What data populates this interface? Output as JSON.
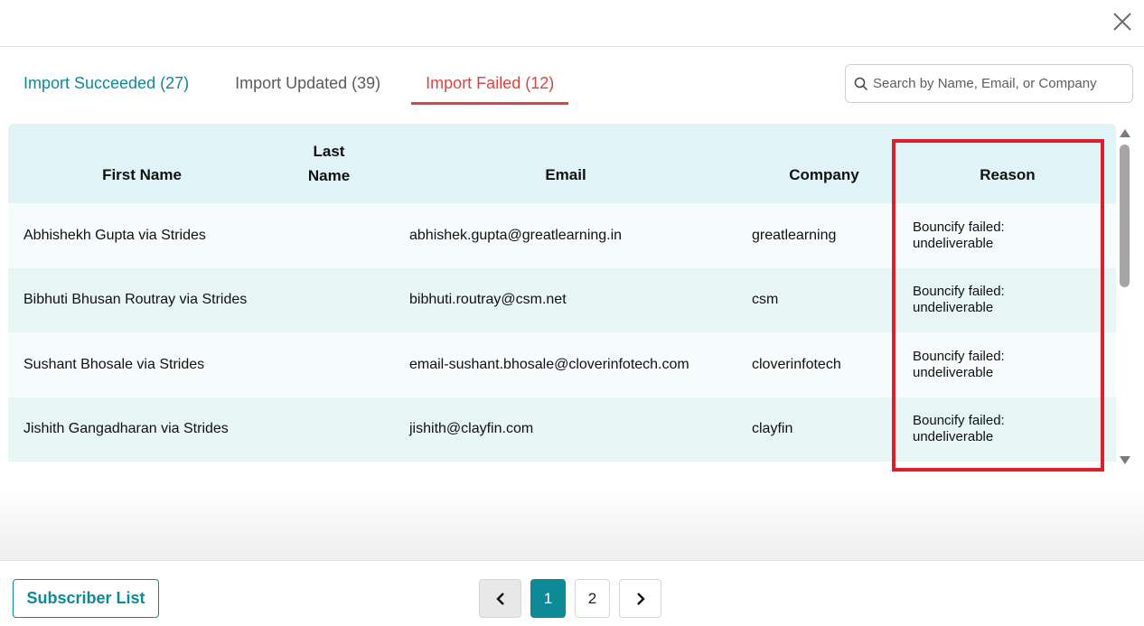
{
  "dialog": {
    "close_icon": "close-icon"
  },
  "tabs": [
    {
      "label": "Import Succeeded (27)",
      "color": "#0e8a96"
    },
    {
      "label": "Import Updated (39)",
      "color": "#5b5b5b"
    },
    {
      "label": "Import Failed (12)",
      "color": "#e2423f",
      "active": true
    }
  ],
  "search": {
    "placeholder": "Search by Name, Email, or Company",
    "value": ""
  },
  "table": {
    "headers": {
      "first_name": "First Name",
      "last_name_line1": "Last",
      "last_name_line2": "Name",
      "email": "Email",
      "company": "Company",
      "reason": "Reason"
    },
    "rows": [
      {
        "first_name": "Abhishekh Gupta via Strides",
        "last_name": "",
        "email": "abhishek.gupta@greatlearning.in",
        "company": "greatlearning",
        "reason_line1": "Bouncify failed:",
        "reason_line2": "undeliverable"
      },
      {
        "first_name": "Bibhuti Bhusan Routray via Strides",
        "last_name": "",
        "email": "bibhuti.routray@csm.net",
        "company": "csm",
        "reason_line1": "Bouncify failed:",
        "reason_line2": "undeliverable"
      },
      {
        "first_name": "Sushant Bhosale via Strides",
        "last_name": "",
        "email": "email-sushant.bhosale@cloverinfotech.com",
        "company": "cloverinfotech",
        "reason_line1": "Bouncify failed:",
        "reason_line2": "undeliverable"
      },
      {
        "first_name": "Jishith Gangadharan via Strides",
        "last_name": "",
        "email": "jishith@clayfin.com",
        "company": "clayfin",
        "reason_line1": "Bouncify failed:",
        "reason_line2": "undeliverable"
      }
    ]
  },
  "footer": {
    "subscriber_list_label": "Subscriber List",
    "pagination": {
      "pages": [
        "1",
        "2"
      ],
      "current_page": "1"
    }
  },
  "colors": {
    "accent": "#0e8a96",
    "error": "#e2423f",
    "highlight": "#e01d2b",
    "header_bg": "#e0f3f7"
  }
}
